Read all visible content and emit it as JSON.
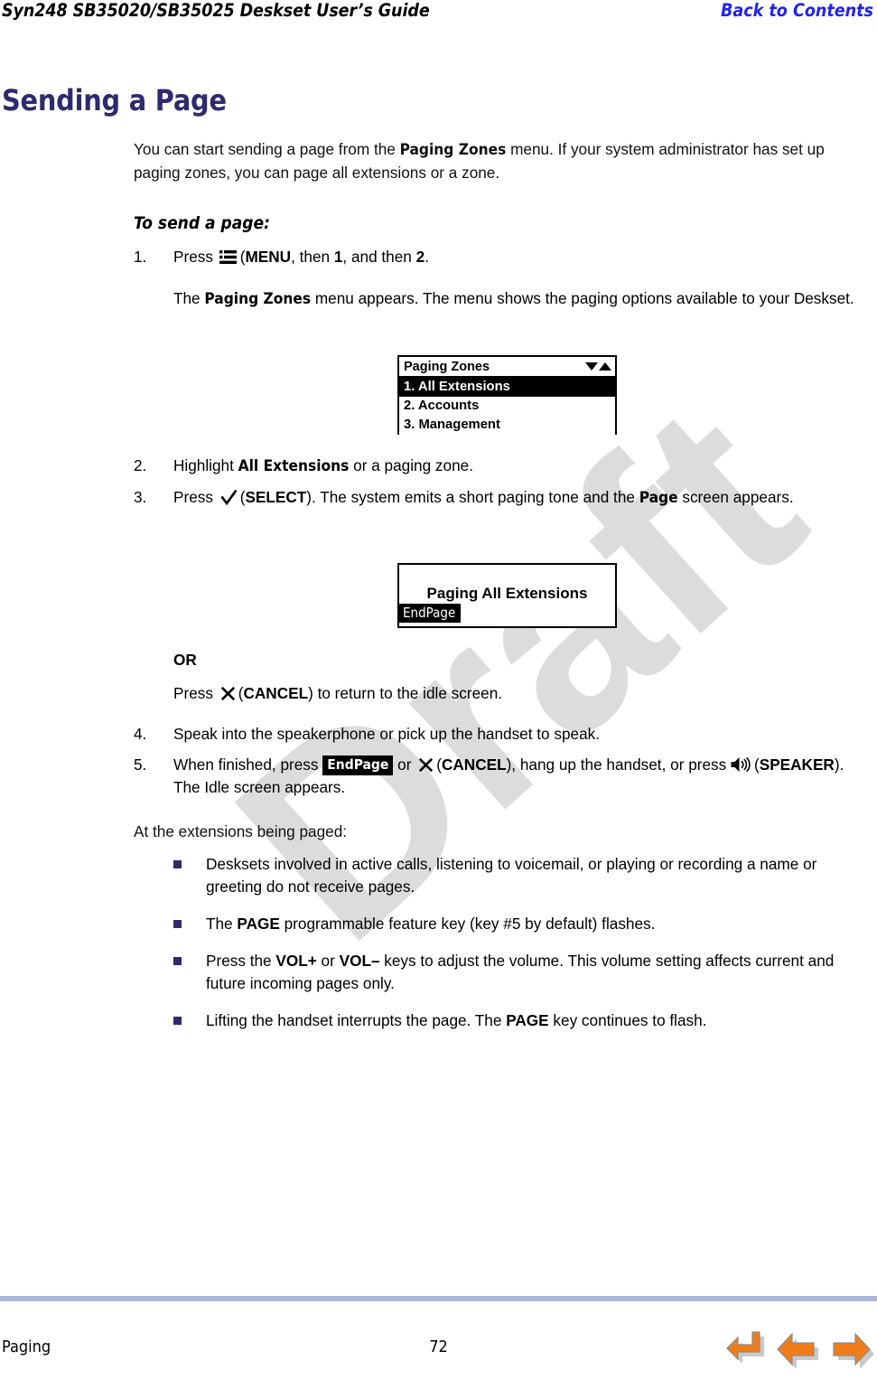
{
  "header": {
    "title": "Syn248 SB35020/SB35025 Deskset User’s Guide",
    "back_link": "Back to Contents"
  },
  "section": {
    "title": "Sending a Page",
    "intro_before_bold": "You can start sending a page from the ",
    "intro_bold": "Paging Zones",
    "intro_after_bold": " menu. If your system administrator has set up paging zones, you can page all extensions or a zone.",
    "procedure_title": "To send a page:"
  },
  "steps": {
    "step1": {
      "num": "1.",
      "press_word": "Press",
      "menu_icon": "menu-icon",
      "menu_label": "MENU",
      "then_word": ", then ",
      "key1": "1",
      "and_then": ", and then ",
      "key2": "2",
      "period": ".",
      "result_before": "The ",
      "result_bold": "Paging Zones",
      "result_after": " menu appears. The menu shows the paging options available to your Deskset."
    },
    "step2": {
      "num": "2.",
      "text_before": "Highlight ",
      "bold": "All Extensions",
      "text_after": " or a paging zone."
    },
    "step3": {
      "num": "3.",
      "press_word": "Press",
      "select_icon": "check-icon",
      "select_label": "SELECT",
      "text_mid": "). The system emits a short paging tone and the ",
      "bold": "Page",
      "text_after": " screen appears."
    },
    "or_label": "OR",
    "or_step": {
      "press_word": "Press",
      "cancel_icon": "close-icon",
      "cancel_label": "CANCEL",
      "text_after": ") to return to the idle screen."
    },
    "step4": {
      "num": "4.",
      "text": "Speak into the speakerphone or pick up the handset to speak."
    },
    "step5": {
      "num": "5.",
      "text_start": "When finished, press ",
      "softkey": "EndPage",
      "text_or": " or ",
      "cancel_icon": "close-icon",
      "cancel_label": "CANCEL",
      "text_mid": "), hang up the handset, or press ",
      "speaker_icon": "speaker-icon",
      "speaker_label": "SPEAKER",
      "text_end": "). The Idle screen appears."
    }
  },
  "lcd_menu": {
    "title": "Paging Zones",
    "arrow_down": "triangle-down-icon",
    "arrow_up": "triangle-up-icon",
    "items": [
      {
        "label": "1. All Extensions",
        "selected": true
      },
      {
        "label": "2. Accounts",
        "selected": false
      },
      {
        "label": "3. Management",
        "selected": false
      }
    ]
  },
  "lcd_page": {
    "title": "Paging All Extensions",
    "softkey": "EndPage"
  },
  "bullets": {
    "intro": "At the extensions being paged:",
    "items": [
      {
        "before": "Desksets involved in active calls, listening to voicemail, or playing or recording a name or greeting do not receive pages.",
        "bold": "",
        "after": ""
      },
      {
        "before": "The ",
        "bold": "PAGE",
        "after": " programmable feature key (key #5 by default) flashes."
      },
      {
        "before": "Press the ",
        "bold": "VOL+",
        "mid": " or ",
        "bold2": "VOL–",
        "after": " keys to adjust the volume. This volume setting affects current and future incoming pages only."
      },
      {
        "before": "Lifting the handset interrupts the page. The ",
        "bold": "PAGE",
        "after": " key continues to flash."
      }
    ]
  },
  "footer": {
    "left": "Paging",
    "page_number": "72",
    "nav": {
      "back_to_contents": "back-arrow-icon",
      "previous": "previous-arrow-icon",
      "next": "next-arrow-icon"
    }
  },
  "watermark": {
    "text": "Draft"
  },
  "colors": {
    "heading": "#2e2a6e",
    "link": "#2222ee",
    "bullet": "#2e2a6e",
    "footer_rule": "#a9b8d8",
    "nav_arrow": "#f07d1a",
    "watermark": "#dcdcdc"
  }
}
